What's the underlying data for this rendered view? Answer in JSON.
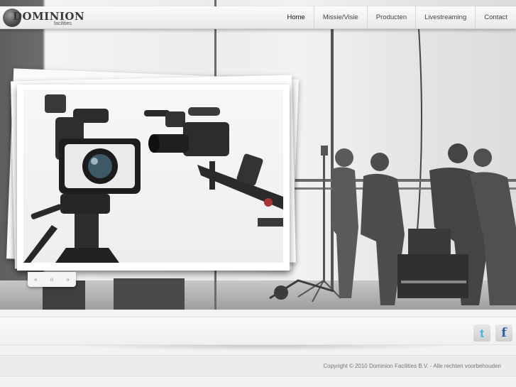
{
  "brand": {
    "name": "DOMINION",
    "sub": "facilities"
  },
  "nav": {
    "items": [
      "Home",
      "Missie/Visie",
      "Producten",
      "Livestreaming",
      "Contact"
    ],
    "active": "Home"
  },
  "slideshow": {
    "controls": [
      "«",
      "ıı",
      "»"
    ]
  },
  "social": {
    "twitter_icon": "t",
    "facebook_icon": "f"
  },
  "footer": {
    "copyright": "Copyright © 2010 Dominion Facilities B.V. - Alle rechten voorbehouden"
  },
  "colors": {
    "twitter": "#1da1f2",
    "facebook": "#2f5aa3",
    "nav_text": "#444444"
  }
}
